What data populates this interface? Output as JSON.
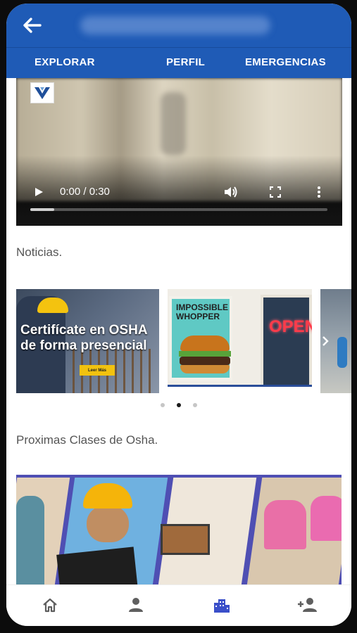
{
  "appbar": {
    "back_icon": "arrow-left-icon",
    "title": ""
  },
  "tabs": [
    {
      "label": "EXPLORAR"
    },
    {
      "label": "PERFIL"
    },
    {
      "label": "EMERGENCIAS"
    }
  ],
  "video": {
    "time": "0:00 / 0:30",
    "progress_fraction": 0.08,
    "controls": [
      "play-icon",
      "volume-icon",
      "fullscreen-icon",
      "more-vert-icon"
    ]
  },
  "news": {
    "title": "Noticias.",
    "slides": [
      {
        "headline_line1": "Certifícate en OSHA",
        "headline_line2": "de forma presencial",
        "button": "Leer Más"
      },
      {
        "poster_title": "IMPOSSIBLE WHOPPER",
        "sign": "OPEN"
      },
      {}
    ],
    "active_dot": 1,
    "dot_count": 3
  },
  "classes": {
    "title": "Proximas Clases de Osha."
  },
  "bottom_nav": [
    {
      "icon": "home-icon"
    },
    {
      "icon": "person-icon"
    },
    {
      "icon": "city-icon",
      "active": true
    },
    {
      "icon": "person-add-icon"
    }
  ],
  "colors": {
    "primary": "#1f5bb6",
    "active_nav": "#3a4fc9",
    "inactive_nav": "#5f5f5f"
  }
}
